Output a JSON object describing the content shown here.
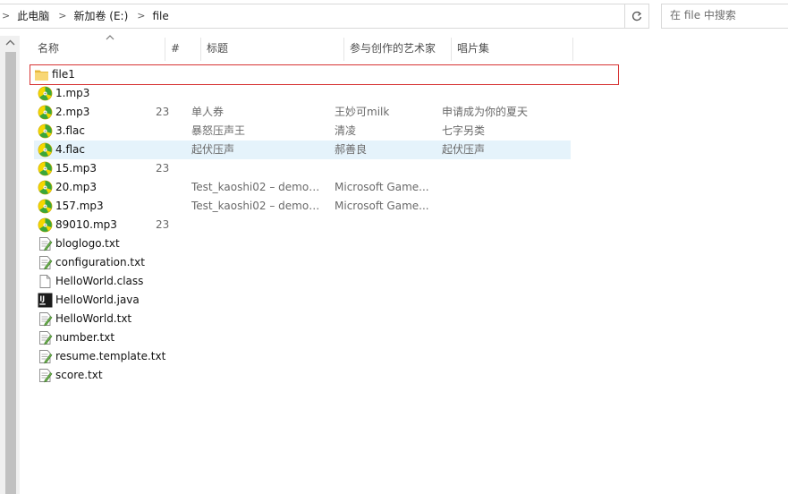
{
  "address": {
    "crumbs": [
      "此电脑",
      "新加卷 (E:)",
      "file"
    ],
    "separator": ">"
  },
  "search": {
    "placeholder": "在 file 中搜索"
  },
  "columns": {
    "name": "名称",
    "number": "#",
    "title": "标题",
    "artist": "参与创作的艺术家",
    "album": "唱片集"
  },
  "files": [
    {
      "name": "file1",
      "icon": "folder-icon",
      "number": "",
      "title": "",
      "artist": "",
      "album": ""
    },
    {
      "name": "1.mp3",
      "icon": "music-file-icon",
      "number": "",
      "title": "",
      "artist": "",
      "album": ""
    },
    {
      "name": "2.mp3",
      "icon": "music-file-icon",
      "number": "23",
      "title": "单人券",
      "artist": "王妙可milk",
      "album": "申请成为你的夏天"
    },
    {
      "name": "3.flac",
      "icon": "music-file-icon",
      "number": "",
      "title": "暴怒压声王",
      "artist": "清凌",
      "album": "七字另类"
    },
    {
      "name": "4.flac",
      "icon": "music-file-icon",
      "number": "",
      "title": "起伏压声",
      "artist": "郝善良",
      "album": "起伏压声"
    },
    {
      "name": "15.mp3",
      "icon": "music-file-icon",
      "number": "23",
      "title": "",
      "artist": "",
      "album": ""
    },
    {
      "name": "20.mp3",
      "icon": "music-file-icon",
      "number": "",
      "title": "Test_kaoshi02 – demo0...",
      "artist": "Microsoft Game...",
      "album": ""
    },
    {
      "name": "157.mp3",
      "icon": "music-file-icon",
      "number": "",
      "title": "Test_kaoshi02 – demo0...",
      "artist": "Microsoft Game...",
      "album": ""
    },
    {
      "name": "89010.mp3",
      "icon": "music-file-icon",
      "number": "23",
      "title": "",
      "artist": "",
      "album": ""
    },
    {
      "name": "bloglogo.txt",
      "icon": "text-file-icon",
      "number": "",
      "title": "",
      "artist": "",
      "album": ""
    },
    {
      "name": "configuration.txt",
      "icon": "text-file-icon",
      "number": "",
      "title": "",
      "artist": "",
      "album": ""
    },
    {
      "name": "HelloWorld.class",
      "icon": "blank-file-icon",
      "number": "",
      "title": "",
      "artist": "",
      "album": ""
    },
    {
      "name": "HelloWorld.java",
      "icon": "intellij-file-icon",
      "number": "",
      "title": "",
      "artist": "",
      "album": ""
    },
    {
      "name": "HelloWorld.txt",
      "icon": "text-file-icon",
      "number": "",
      "title": "",
      "artist": "",
      "album": ""
    },
    {
      "name": "number.txt",
      "icon": "text-file-icon",
      "number": "",
      "title": "",
      "artist": "",
      "album": ""
    },
    {
      "name": "resume.template.txt",
      "icon": "text-file-icon",
      "number": "",
      "title": "",
      "artist": "",
      "album": ""
    },
    {
      "name": "score.txt",
      "icon": "text-file-icon",
      "number": "",
      "title": "",
      "artist": "",
      "album": ""
    }
  ],
  "state": {
    "focused_index": 0,
    "selected_index": 4
  },
  "colors": {
    "selection": "#e5f3fb",
    "focus_outline": "#d73535",
    "folder": "#f8d775",
    "music_yellow": "#f5d800",
    "music_green": "#3aa63a"
  }
}
